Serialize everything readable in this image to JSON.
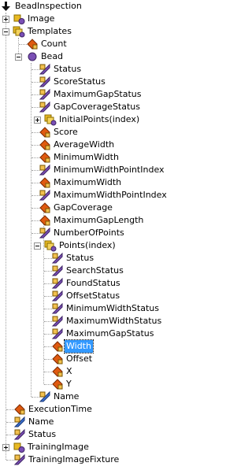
{
  "tree": {
    "root_label": "BeadInspection",
    "image_label": "Image",
    "templates_label": "Templates",
    "count_label": "Count",
    "bead_label": "Bead",
    "bead_children": [
      "Status",
      "ScoreStatus",
      "MaximumGapStatus",
      "GapCoverageStatus",
      "InitialPoints(index)",
      "Score",
      "AverageWidth",
      "MinimumWidth",
      "MinimumWidthPointIndex",
      "MaximumWidth",
      "MaximumWidthPointIndex",
      "GapCoverage",
      "MaximumGapLength",
      "NumberOfPoints",
      "Points(index)"
    ],
    "points_children": [
      "Status",
      "SearchStatus",
      "FoundStatus",
      "OffsetStatus",
      "MinimumWidthStatus",
      "MaximumWidthStatus",
      "MaximumGapStatus",
      "Width",
      "Offset",
      "X",
      "Y"
    ],
    "bead_name_label": "Name",
    "root_children": [
      "ExecutionTime",
      "Name",
      "Status",
      "TrainingImage",
      "TrainingImageFixture"
    ],
    "selected_item": "Width"
  },
  "colors": {
    "selection": "#3399ff",
    "property_icon": "#7a4fb5",
    "status_icon": "#e05a10",
    "name_icon": "#3a6ecf"
  }
}
